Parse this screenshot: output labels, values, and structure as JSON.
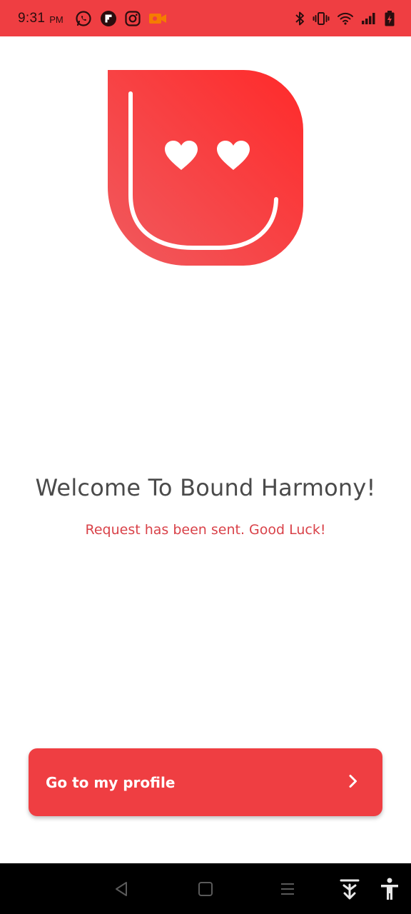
{
  "status_bar": {
    "time": "9:31",
    "ampm": "PM",
    "background": "#ef3e42",
    "left_icons": [
      "whatsapp-icon",
      "flipboard-icon",
      "instagram-icon",
      "video-recorder-icon"
    ],
    "right_icons": [
      "bluetooth-icon",
      "vibrate-icon",
      "wifi-icon",
      "signal-icon",
      "battery-charging-icon"
    ]
  },
  "logo": {
    "icon": "smiley-heart-eyes-logo",
    "gradient_start": "#f05a5e",
    "gradient_end": "#ff2a2a"
  },
  "welcome": {
    "title": "Welcome To Bound Harmony!",
    "subtitle": "Request has been sent. Good Luck!"
  },
  "actions": {
    "profile_button_label": "Go to my profile",
    "profile_button_icon": "chevron-right-icon",
    "accent": "#ef3e42"
  },
  "nav_bar": {
    "icons": [
      "back-icon",
      "home-icon",
      "recents-icon",
      "download-icon",
      "accessibility-icon"
    ]
  }
}
